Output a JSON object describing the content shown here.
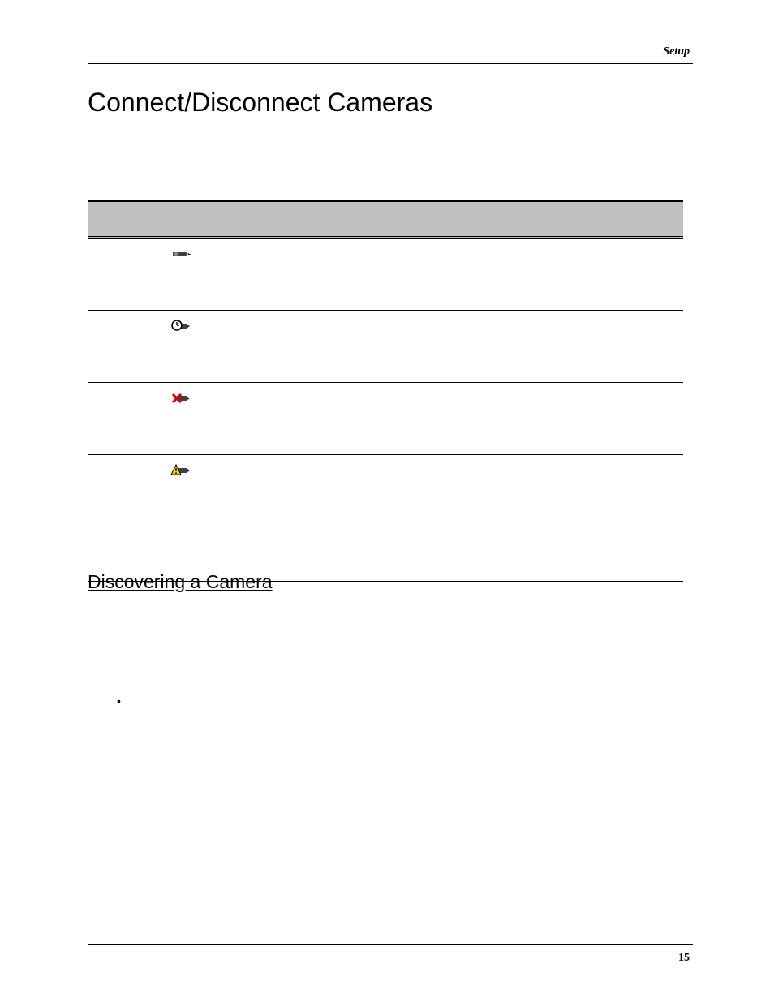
{
  "header": {
    "section_label": "Setup"
  },
  "heading": "Connect/Disconnect Cameras",
  "subheading": "Discovering a Camera",
  "page_number": "15",
  "table": {
    "rows": [
      {
        "icon": "camera-connected",
        "desc": ""
      },
      {
        "icon": "camera-clock",
        "desc": ""
      },
      {
        "icon": "camera-disconnected",
        "desc": ""
      },
      {
        "icon": "camera-warning",
        "desc": ""
      },
      {
        "icon": "",
        "desc": ""
      }
    ]
  }
}
